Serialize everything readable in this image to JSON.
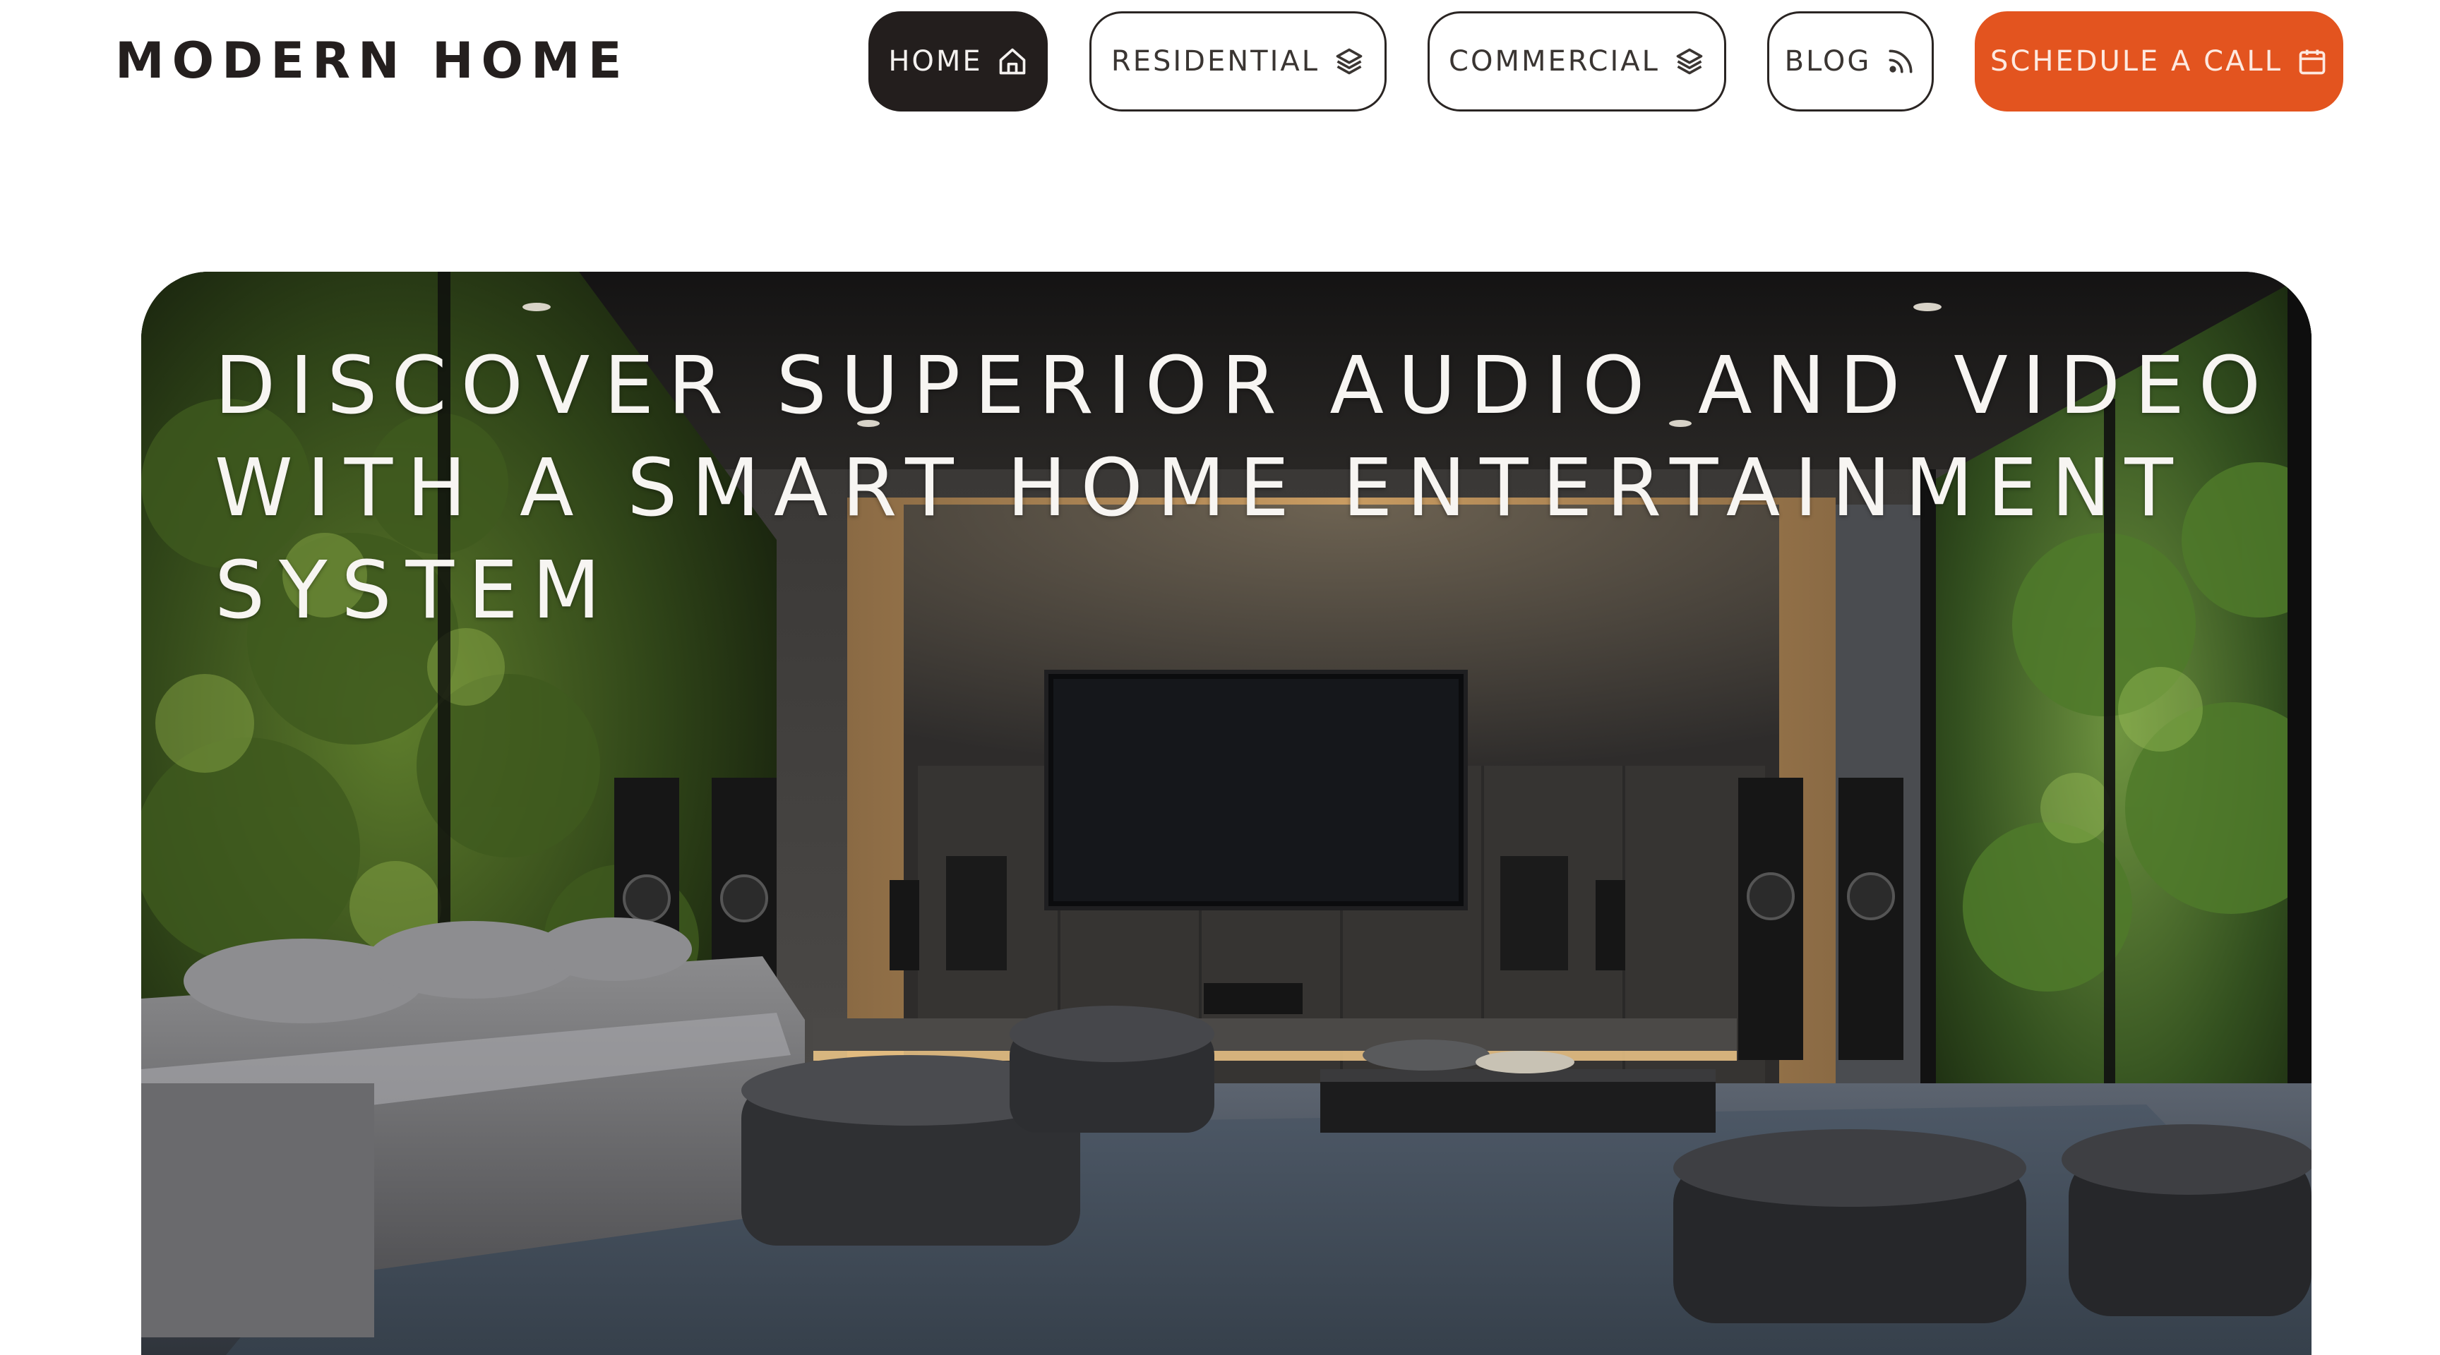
{
  "header": {
    "logo": "MODERN HOME",
    "nav": [
      {
        "label": "HOME",
        "icon": "home-icon",
        "active": true
      },
      {
        "label": "RESIDENTIAL",
        "icon": "layers-icon",
        "active": false
      },
      {
        "label": "COMMERCIAL",
        "icon": "layers-icon",
        "active": false
      },
      {
        "label": "BLOG",
        "icon": "rss-icon",
        "active": false
      }
    ],
    "cta": {
      "label": "SCHEDULE A CALL",
      "icon": "calendar-icon"
    }
  },
  "hero": {
    "headline": "DISCOVER SUPERIOR AUDIO AND VIDEO WITH A SMART HOME ENTERTAINMENT SYSTEM",
    "image": "living-room-home-theater-photo"
  },
  "colors": {
    "dark": "#231e1d",
    "accent": "#e3541f",
    "background": "#ffffff"
  }
}
